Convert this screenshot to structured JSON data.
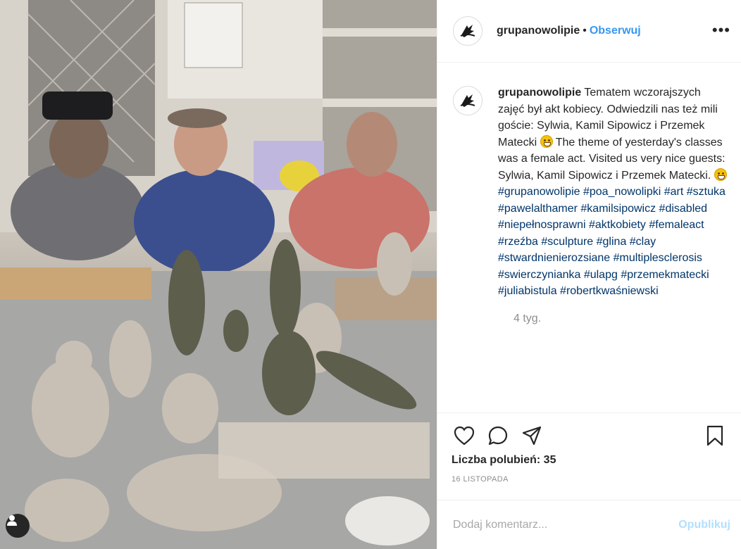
{
  "post": {
    "username": "grupanowolipie",
    "follow_label": "Obserwuj",
    "separator": "•",
    "more_label": "•••"
  },
  "caption": {
    "username": "grupanowolipie",
    "text_part1": " Tematem wczorajszych zajęć był akt kobiecy. Odwiedzili nas też mili goście: Sylwia, Kamil Sipowicz i Przemek Matecki ",
    "text_part2": " The theme of yesterday's classes was a female act. Visited us very nice guests: Sylwia, Kamil Sipowicz i Przemek Matecki. ",
    "hashtags": "#grupanowolipie #poa_nowolipki #art #sztuka #pawelalthamer #kamilsipowicz #disabled #niepełnosprawni #aktkobiety #femaleact #rzeźba #sculpture #glina #clay #stwardnienierozsiane #multiplesclerosis #swierczynianka #ulapg #przemekmatecki #juliabistula #robertkwaśniewski",
    "time_ago": "4 tyg."
  },
  "actions": {
    "icons": [
      "heart-icon",
      "comment-icon",
      "share-icon",
      "bookmark-icon"
    ],
    "likes_label": "Liczba polubień: 35",
    "date": "16 LISTOPADA"
  },
  "comment": {
    "placeholder": "Dodaj komentarz...",
    "post_label": "Opublikuj"
  },
  "colors": {
    "link": "#3897f0",
    "hashtag": "#003569",
    "muted": "#8e8e8e",
    "post_disabled": "#b2dffc"
  }
}
